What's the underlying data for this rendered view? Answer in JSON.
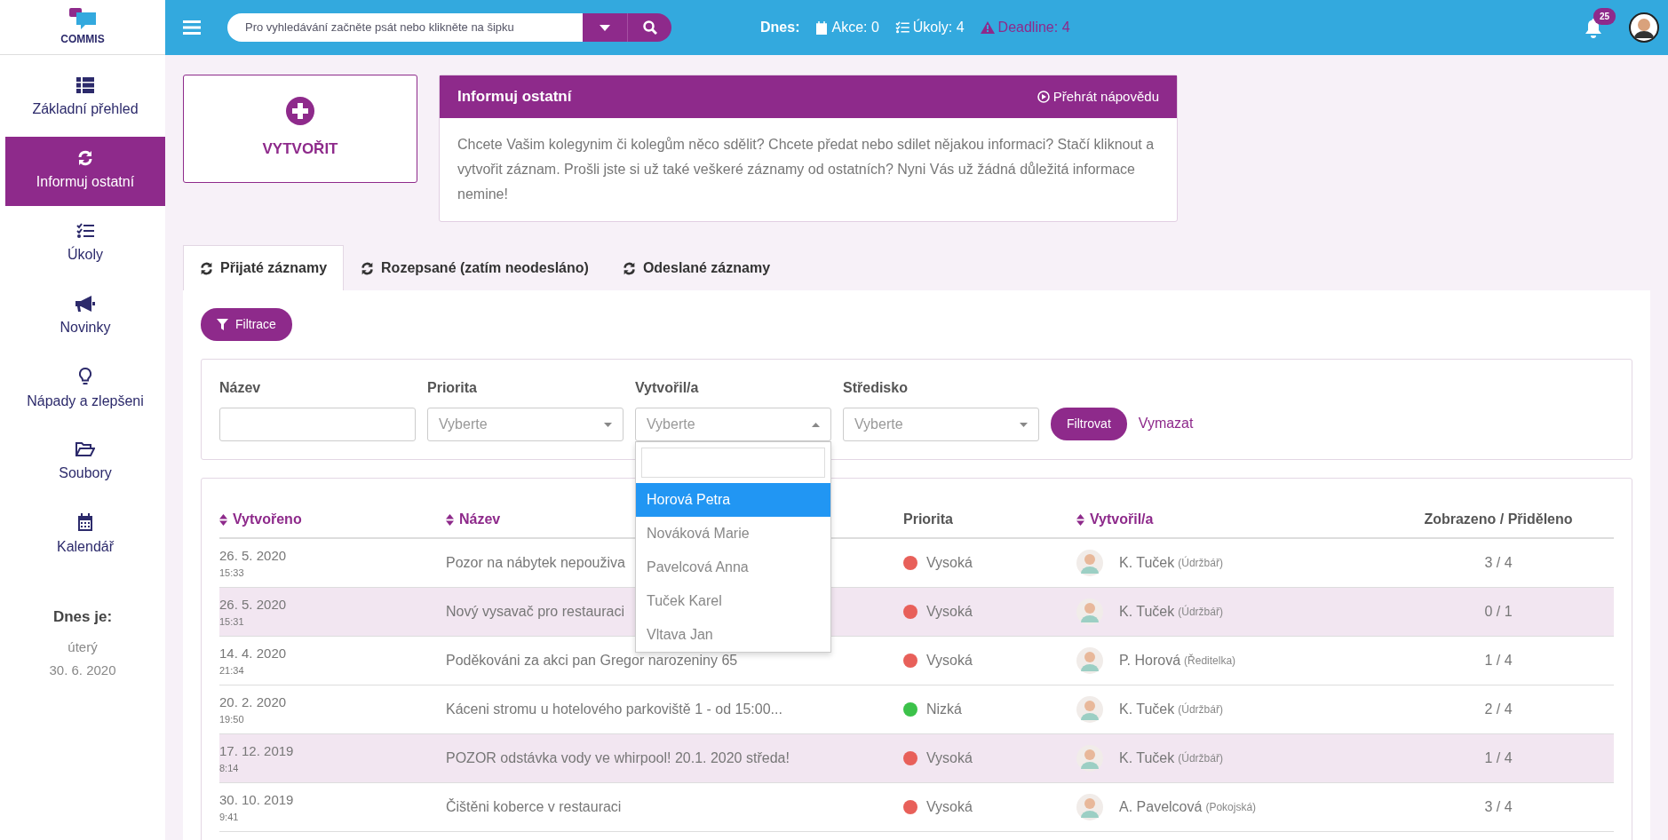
{
  "logo": {
    "text": "COMMIS"
  },
  "search": {
    "placeholder": "Pro vyhledávání začněte psát nebo klikněte na šipku"
  },
  "today_bar": {
    "label": "Dnes:",
    "items": [
      {
        "kind": "events",
        "text": "Akce: 0"
      },
      {
        "kind": "tasks",
        "text": "Úkoly: 4"
      },
      {
        "kind": "deadline",
        "text": "Deadline: 4"
      }
    ]
  },
  "notifications": {
    "count": "25"
  },
  "sidebar": {
    "items": [
      {
        "label": "Základní přehled",
        "selected": false
      },
      {
        "label": "Informuj ostatní",
        "selected": true
      },
      {
        "label": "Úkoly",
        "selected": false
      },
      {
        "label": "Novinky",
        "selected": false
      },
      {
        "label": "Nápady a zlepšeni",
        "selected": false
      },
      {
        "label": "Soubory",
        "selected": false
      },
      {
        "label": "Kalendář",
        "selected": false
      }
    ],
    "today": {
      "title": "Dnes je:",
      "day": "úterý",
      "date": "30. 6. 2020"
    }
  },
  "create_button": {
    "label": "VYTVOŘIT"
  },
  "info_panel": {
    "title": "Informuj ostatní",
    "help_link": "Přehrát nápovědu",
    "text": "Chcete Vašim kolegynim či kolegům něco sdělit? Chcete předat nebo sdilet nějakou informaci? Stačí kliknout a vytvořit záznam. Prošli jste si už také veškeré záznamy od ostatních? Nyni Vás už žádná důležitá informace nemine!"
  },
  "tabs": [
    {
      "label": "Přijaté záznamy",
      "selected": true
    },
    {
      "label": "Rozepsané (zatím neodesláno)",
      "selected": false
    },
    {
      "label": "Odeslané záznamy",
      "selected": false
    }
  ],
  "filter_button": {
    "label": "Filtrace"
  },
  "filters": {
    "fields": [
      {
        "kind": "text",
        "label": "Název"
      },
      {
        "kind": "select",
        "label": "Priorita",
        "placeholder": "Vyberte",
        "expanded": false
      },
      {
        "kind": "select",
        "label": "Vytvořil/a",
        "placeholder": "Vyberte",
        "expanded": true,
        "options": [
          {
            "label": "Horová Petra",
            "selected": true
          },
          {
            "label": "Nováková Marie",
            "selected": false
          },
          {
            "label": "Pavelcová Anna",
            "selected": false
          },
          {
            "label": "Tuček Karel",
            "selected": false
          },
          {
            "label": "Vltava Jan",
            "selected": false
          }
        ]
      },
      {
        "kind": "select",
        "label": "Středisko",
        "placeholder": "Vyberte",
        "expanded": false
      }
    ],
    "apply": "Filtrovat",
    "clear": "Vymazat"
  },
  "table": {
    "columns": [
      {
        "label": "Vytvořeno",
        "sortable": true
      },
      {
        "label": "Název",
        "sortable": true
      },
      {
        "label": "Priorita",
        "sortable": false
      },
      {
        "label": "Vytvořil/a",
        "sortable": true
      },
      {
        "label": "Zobrazeno / Přiděleno",
        "sortable": false
      }
    ],
    "rows": [
      {
        "date": "26. 5. 2020",
        "time": "15:33",
        "title": "Pozor na nábytek nepouživa",
        "priority": "Vysoká",
        "color": "#e8605a",
        "author": "K. Tuček",
        "role": "(Údržbář)",
        "views": "3 / 4",
        "highlighted": false
      },
      {
        "date": "26. 5. 2020",
        "time": "15:31",
        "title": "Nový vysavač pro restauraci",
        "priority": "Vysoká",
        "color": "#e8605a",
        "author": "K. Tuček",
        "role": "(Údržbář)",
        "views": "0 / 1",
        "highlighted": true
      },
      {
        "date": "14. 4. 2020",
        "time": "21:34",
        "title": "Poděkováni za akci pan Gregor narozeniny 65",
        "priority": "Vysoká",
        "color": "#e8605a",
        "author": "P. Horová",
        "role": "(Ředitelka)",
        "views": "1 / 4",
        "highlighted": false
      },
      {
        "date": "20. 2. 2020",
        "time": "19:50",
        "title": "Káceni stromu u hotelového parkoviště 1 - od 15:00...",
        "priority": "Nizká",
        "color": "#3cc24a",
        "author": "K. Tuček",
        "role": "(Údržbář)",
        "views": "2 / 4",
        "highlighted": false
      },
      {
        "date": "17. 12. 2019",
        "time": "8:14",
        "title": "POZOR odstávka vody ve whirpool! 20.1. 2020 středa!",
        "priority": "Vysoká",
        "color": "#e8605a",
        "author": "K. Tuček",
        "role": "(Údržbář)",
        "views": "1 / 4",
        "highlighted": true
      },
      {
        "date": "30. 10. 2019",
        "time": "9:41",
        "title": "Čištěni koberce v restauraci",
        "priority": "Vysoká",
        "color": "#e8605a",
        "author": "A. Pavelcová",
        "role": "(Pokojská)",
        "views": "3 / 4",
        "highlighted": false
      }
    ]
  }
}
